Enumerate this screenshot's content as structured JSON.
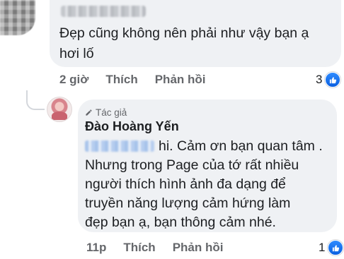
{
  "comment_1": {
    "text_lines": [
      "Đẹp cũng không nên phải như vậy bạn ạ",
      "hơi lố"
    ],
    "time": "2 giờ",
    "like_label": "Thích",
    "reply_label": "Phản hồi",
    "reaction_count": "3",
    "reaction_icon": "like-icon"
  },
  "reply_1": {
    "badge": "Tác giả",
    "author": "Đào Hoàng Yến",
    "text_lines": [
      "hi. Cảm ơn bạn quan tâm .",
      "Nhưng trong Page của tớ rất nhiều",
      "người thích hình ảnh đa dạng để",
      "truyền năng lượng cảm hứng làm",
      "đẹp bạn ạ, bạn thông cảm nhé."
    ],
    "time": "11p",
    "like_label": "Thích",
    "reply_label": "Phản hồi",
    "reaction_count": "1",
    "reaction_icon": "like-icon"
  },
  "colors": {
    "bubble": "#eff1f4",
    "meta_text": "#65676b",
    "like_blue": "#1877f2"
  }
}
